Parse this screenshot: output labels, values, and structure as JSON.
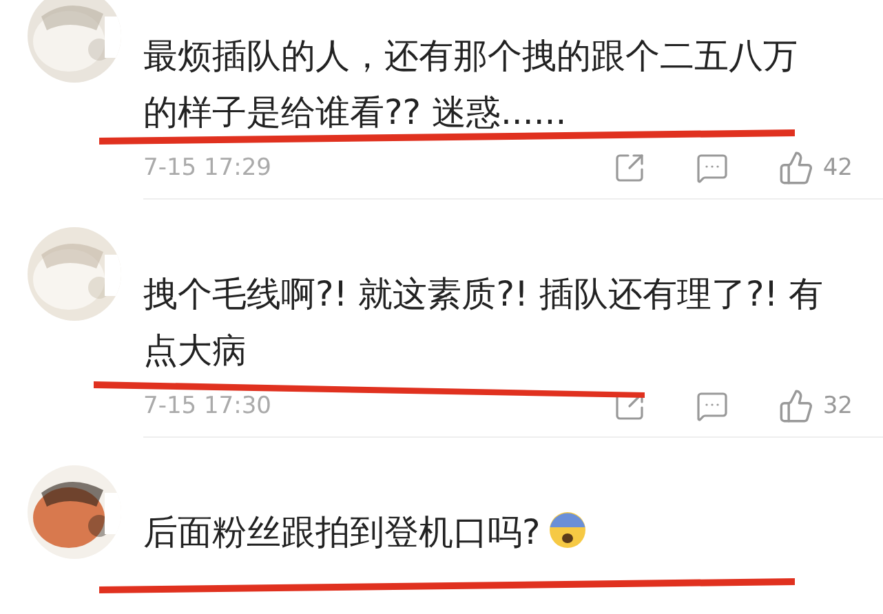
{
  "comments": [
    {
      "text": "最烦插队的人，还有那个拽的跟个二五八万的样子是给谁看?? 迷惑......",
      "underlined": true,
      "time": "7-15 17:29",
      "likes": "42"
    },
    {
      "text": "拽个毛线啊?! 就这素质?! 插队还有理了?! 有点大病",
      "underlined": true,
      "time": "7-15 17:30",
      "likes": "32"
    },
    {
      "text": "后面粉丝跟拍到登机口吗?",
      "emoji": true,
      "underlined": true
    }
  ]
}
